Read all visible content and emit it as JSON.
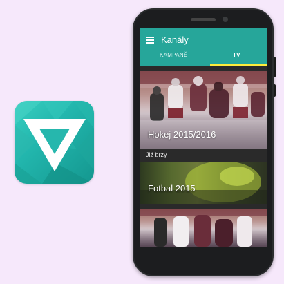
{
  "app": {
    "title": "Kanály",
    "tabs": [
      {
        "label": "KAMPANĚ",
        "active": false
      },
      {
        "label": "TV",
        "active": true
      }
    ],
    "accent_color": "#26a69a",
    "indicator_color": "#ffeb3b"
  },
  "feed": {
    "cards": [
      {
        "label": "Hokej 2015/2016",
        "scene": "hockey"
      },
      {
        "label": "Fotbal 2015",
        "scene": "football"
      }
    ],
    "section_header": "Již brzy"
  },
  "icons": {
    "menu": "menu-icon",
    "app_logo": "triangle-v-logo-icon"
  }
}
